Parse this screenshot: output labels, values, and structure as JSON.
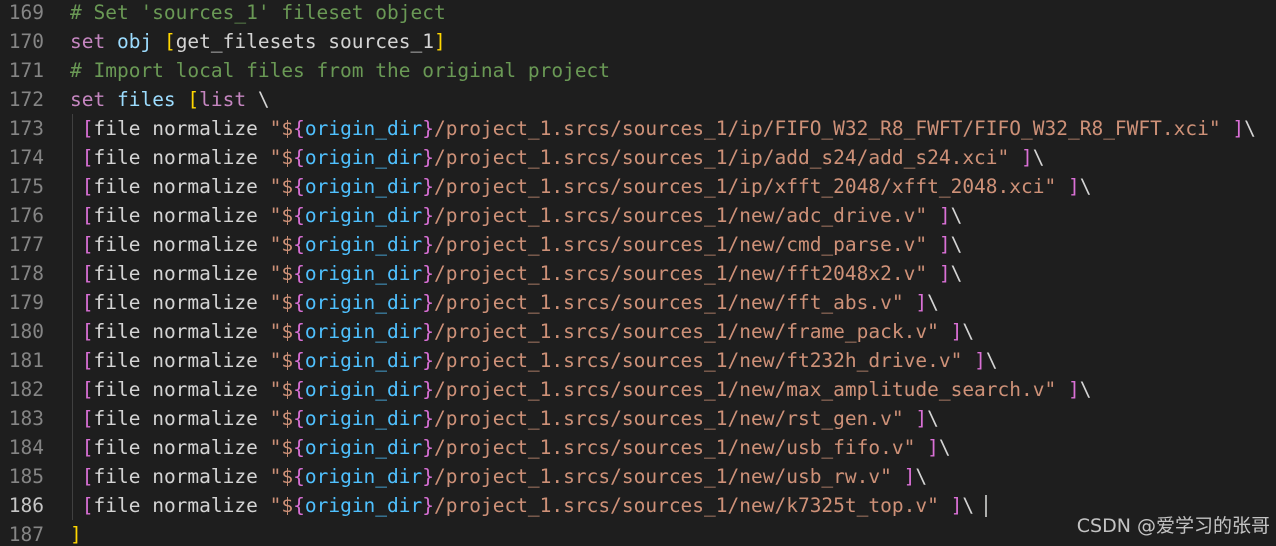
{
  "editor": {
    "theme_colors": {
      "background": "#1e1e1e",
      "line_number": "#858585",
      "comment": "#6a9955",
      "keyword": "#c586c0",
      "variable": "#9cdcfe",
      "string": "#ce9178",
      "bracket_gold": "#ffd700",
      "bracket_pink": "#da70d6",
      "interp_var": "#4fc1ff"
    },
    "active_line": "186",
    "lines": [
      {
        "num": "169",
        "tokens": [
          {
            "t": "# Set 'sources_1' fileset object",
            "c": "comment"
          }
        ]
      },
      {
        "num": "170",
        "tokens": [
          {
            "t": "set ",
            "c": "keyword"
          },
          {
            "t": "obj ",
            "c": "var"
          },
          {
            "t": "[",
            "c": "bracket1"
          },
          {
            "t": "get_filesets sources_1",
            "c": "plain"
          },
          {
            "t": "]",
            "c": "bracket1"
          }
        ]
      },
      {
        "num": "171",
        "tokens": [
          {
            "t": "# Import local files from the original project",
            "c": "comment"
          }
        ]
      },
      {
        "num": "172",
        "tokens": [
          {
            "t": "set ",
            "c": "keyword"
          },
          {
            "t": "files ",
            "c": "var"
          },
          {
            "t": "[",
            "c": "bracket1"
          },
          {
            "t": "list ",
            "c": "keyword"
          },
          {
            "t": "\\",
            "c": "plain"
          }
        ]
      },
      {
        "num": "173",
        "path": "/project_1.srcs/sources_1/ip/FIFO_W32_R8_FWFT/FIFO_W32_R8_FWFT.xci"
      },
      {
        "num": "174",
        "path": "/project_1.srcs/sources_1/ip/add_s24/add_s24.xci"
      },
      {
        "num": "175",
        "path": "/project_1.srcs/sources_1/ip/xfft_2048/xfft_2048.xci"
      },
      {
        "num": "176",
        "path": "/project_1.srcs/sources_1/new/adc_drive.v"
      },
      {
        "num": "177",
        "path": "/project_1.srcs/sources_1/new/cmd_parse.v"
      },
      {
        "num": "178",
        "path": "/project_1.srcs/sources_1/new/fft2048x2.v"
      },
      {
        "num": "179",
        "path": "/project_1.srcs/sources_1/new/fft_abs.v"
      },
      {
        "num": "180",
        "path": "/project_1.srcs/sources_1/new/frame_pack.v"
      },
      {
        "num": "181",
        "path": "/project_1.srcs/sources_1/new/ft232h_drive.v"
      },
      {
        "num": "182",
        "path": "/project_1.srcs/sources_1/new/max_amplitude_search.v"
      },
      {
        "num": "183",
        "path": "/project_1.srcs/sources_1/new/rst_gen.v"
      },
      {
        "num": "184",
        "path": "/project_1.srcs/sources_1/new/usb_fifo.v"
      },
      {
        "num": "185",
        "path": "/project_1.srcs/sources_1/new/usb_rw.v"
      },
      {
        "num": "186",
        "path": "/project_1.srcs/sources_1/new/k7325t_top.v"
      },
      {
        "num": "187",
        "tokens": [
          {
            "t": "]",
            "c": "bracket1"
          }
        ]
      }
    ],
    "file_line_parts": {
      "open": "[",
      "cmd": "file normalize ",
      "quote_open": "\"",
      "dollar": "$",
      "brace_open": "{",
      "var": "origin_dir",
      "brace_close": "}",
      "quote_close": "\" ",
      "close": "]",
      "cont": "\\"
    }
  },
  "watermark": "CSDN @爱学习的张哥"
}
